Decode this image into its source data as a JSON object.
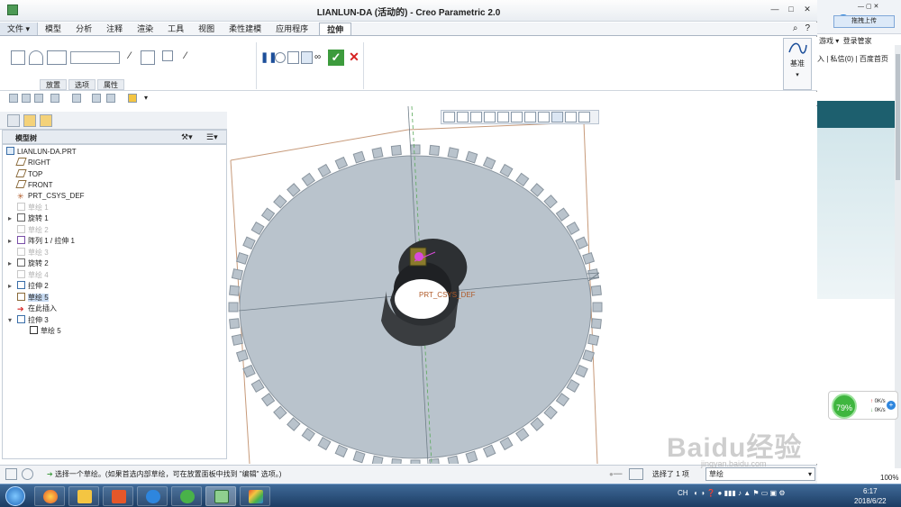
{
  "window": {
    "title": "LIANLUN-DA (活动的) - Creo Parametric 2.0"
  },
  "menu": {
    "file": "文件",
    "tabs": [
      "模型",
      "分析",
      "注释",
      "渲染",
      "工具",
      "视图",
      "柔性建模",
      "应用程序"
    ],
    "active_tab": "拉伸"
  },
  "ribbon": {
    "subtabs": [
      "放置",
      "选项",
      "属性"
    ],
    "datum_label": "基准"
  },
  "tree": {
    "header": "模型树",
    "items": [
      {
        "label": "LIANLUN-DA.PRT",
        "dim": false
      },
      {
        "label": "RIGHT",
        "dim": false
      },
      {
        "label": "TOP",
        "dim": false
      },
      {
        "label": "FRONT",
        "dim": false
      },
      {
        "label": "PRT_CSYS_DEF",
        "dim": false
      },
      {
        "label": "草绘 1",
        "dim": true
      },
      {
        "label": "旋转 1",
        "dim": false
      },
      {
        "label": "草绘 2",
        "dim": true
      },
      {
        "label": "阵列 1 / 拉伸 1",
        "dim": false
      },
      {
        "label": "草绘 3",
        "dim": true
      },
      {
        "label": "旋转 2",
        "dim": false
      },
      {
        "label": "草绘 4",
        "dim": true
      },
      {
        "label": "拉伸 2",
        "dim": false
      },
      {
        "label": "草绘 5",
        "dim": false
      },
      {
        "label": "在此插入",
        "dim": false
      },
      {
        "label": "拉伸 3",
        "dim": false
      },
      {
        "label": "草绘 5",
        "dim": false
      }
    ]
  },
  "viewport": {
    "csys_label": "PRT_CSYS_DEF"
  },
  "status": {
    "message": "选择一个草绘。(如果首选内部草绘，可在放置面板中找到 \"编辑\" 选项。)",
    "selected": "选择了 1 项",
    "filter": "草绘"
  },
  "side": {
    "upload": "拖拽上传",
    "game": "游戏",
    "login": "登录管家",
    "line2": "入 | 私信(0) | 百度首页",
    "zoom": "100%"
  },
  "speed": {
    "percent": "79%",
    "up": "0K/s",
    "down": "0K/s"
  },
  "watermark": {
    "logo": "Baidu经验",
    "url": "jingyan.baidu.com"
  },
  "taskbar": {
    "lang": "CH",
    "time": "6:17",
    "date": "2018/6/22"
  },
  "colors": {
    "gear": "#b9c3cc",
    "accent": "#3d9b3d",
    "datum_plane": "#b05a28"
  }
}
